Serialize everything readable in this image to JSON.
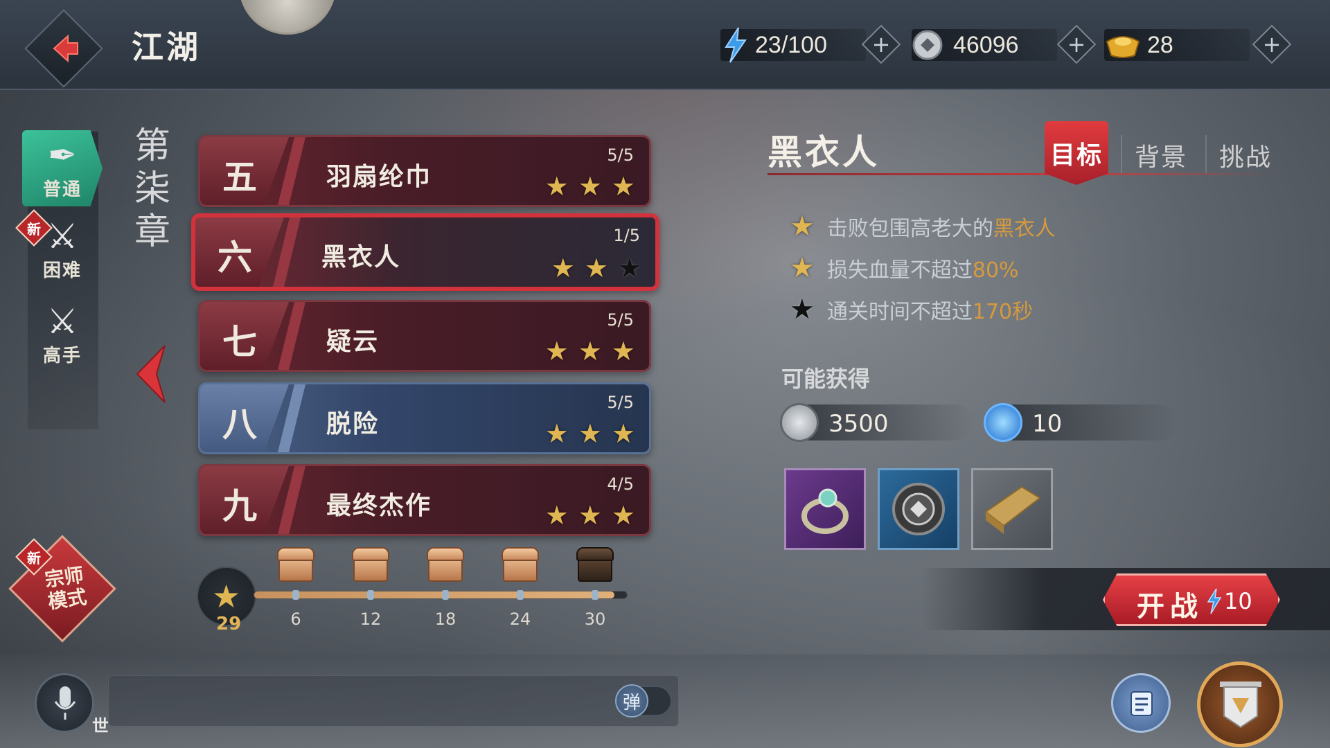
{
  "header": {
    "title": "江湖",
    "stamina": "23/100",
    "coins": "46096",
    "ingots": "28"
  },
  "modes": [
    {
      "label": "普通",
      "active": true,
      "new": false
    },
    {
      "label": "困难",
      "active": false,
      "new": true,
      "badge": "新"
    },
    {
      "label": "高手",
      "active": false,
      "new": false
    }
  ],
  "chapter": {
    "title": [
      "第",
      "柒",
      "章"
    ]
  },
  "levels": [
    {
      "num": "五",
      "name": "羽扇纶巾",
      "progress": "5/5",
      "stars": 3,
      "style": "red",
      "active": false
    },
    {
      "num": "六",
      "name": "黑衣人",
      "progress": "1/5",
      "stars": 2,
      "style": "red",
      "active": true
    },
    {
      "num": "七",
      "name": "疑云",
      "progress": "5/5",
      "stars": 3,
      "style": "red",
      "active": false
    },
    {
      "num": "八",
      "name": "脱险",
      "progress": "5/5",
      "stars": 3,
      "style": "blue",
      "active": false
    },
    {
      "num": "九",
      "name": "最终杰作",
      "progress": "4/5",
      "stars": 3,
      "style": "red",
      "active": false
    }
  ],
  "star_progress": {
    "current": "29",
    "max": 30,
    "milestones": [
      "6",
      "12",
      "18",
      "24",
      "30"
    ],
    "chests_opened": [
      true,
      true,
      true,
      true,
      false
    ]
  },
  "master_mode": {
    "badge": "新",
    "label_line1": "宗师",
    "label_line2": "模式"
  },
  "detail": {
    "name": "黑衣人",
    "tabs": [
      "目标",
      "背景",
      "挑战"
    ],
    "active_tab": "目标",
    "objectives": [
      {
        "text": "击败包围高老大的",
        "highlight": "黑衣人",
        "achieved": true
      },
      {
        "text": "损失血量不超过",
        "highlight": "80%",
        "achieved": true
      },
      {
        "text": "通关时间不超过",
        "highlight": "170秒",
        "achieved": false
      }
    ],
    "rewards_title": "可能获得",
    "reward_coins": "3500",
    "reward_exp": "10",
    "items": [
      "ring-item",
      "badge-item",
      "cloth-item"
    ]
  },
  "start": {
    "label": "开战",
    "cost": "10"
  },
  "chat": {
    "channel": "世",
    "danmu_label": "弹"
  },
  "colors": {
    "accent_red": "#d2323b",
    "star_gold": "#e0b652",
    "highlight_orange": "#d79a3c",
    "mode_green": "#2fa985"
  }
}
